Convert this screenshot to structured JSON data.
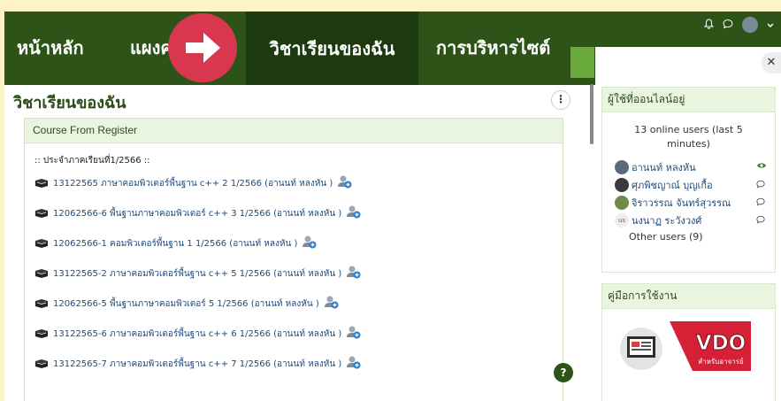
{
  "nav": {
    "home": "หน้าหลัก",
    "dashboard": "แผงค",
    "my_courses": "วิชาเรียนของฉัน",
    "site_admin": "การบริหารไซต์"
  },
  "top_icons": [
    "bell-icon",
    "chat-icon",
    "user-avatar",
    "chevron-down-icon"
  ],
  "page": {
    "title": "วิชาเรียนของฉัน",
    "menu_glyph": "⋮",
    "help_glyph": "?"
  },
  "course_block": {
    "heading": "Course From Register",
    "term": ":: ประจำภาคเรียนที่1/2566 ::",
    "courses": [
      {
        "label": "13122565 ภาษาคอมพิวเตอร์พื้นฐาน c++ 2 1/2566 (อานนท์ หลงหัน )"
      },
      {
        "label": "12062566-6 พื้นฐานภาษาคอมพิวเตอร์ c++ 3 1/2566 (อานนท์ หลงหัน )"
      },
      {
        "label": "12062566-1 คอมพิวเตอร์พื้นฐาน 1 1/2566 (อานนท์ หลงหัน )"
      },
      {
        "label": "13122565-2 ภาษาคอมพิวเตอร์พื้นฐาน c++ 5 1/2566 (อานนท์ หลงหัน )"
      },
      {
        "label": "12062566-5 พื้นฐานภาษาคอมพิวเตอร์ 5 1/2566 (อานนท์ หลงหัน )"
      },
      {
        "label": "13122565-6 ภาษาคอมพิวเตอร์พื้นฐาน c++ 6 1/2566 (อานนท์ หลงหัน )"
      },
      {
        "label": "13122565-7 ภาษาคอมพิวเตอร์พื้นฐาน c++ 7 1/2566 (อานนท์ หลงหัน )"
      }
    ]
  },
  "online_block": {
    "heading": "ผู้ใช้ที่ออนไลน์อยู่",
    "summary": "13 online users (last 5 minutes)",
    "users": [
      {
        "name": "อานนท์ หลงหัน",
        "action_icon": "eye-icon"
      },
      {
        "name": "ศุภพิชญาณ์ บุญเกื้อ",
        "action_icon": "message-icon"
      },
      {
        "name": "จิราวรรณ จันทร์สุวรรณ",
        "action_icon": "message-icon"
      },
      {
        "name": "นงนาฏ ระวังวงศ์",
        "initials": "us",
        "action_icon": "message-icon"
      }
    ],
    "other": "Other users (9)"
  },
  "manual_block": {
    "heading": "คู่มือการใช้งาน",
    "vdo_text": "VDO",
    "vdo_sub": "สำหรับอาจารย์"
  },
  "colors": {
    "navbar": "#2e5318",
    "navbar_active": "#1d3a0e",
    "block_header": "#eaf5df",
    "arrow_badge": "#d9374f",
    "link": "#1d4a7a"
  }
}
